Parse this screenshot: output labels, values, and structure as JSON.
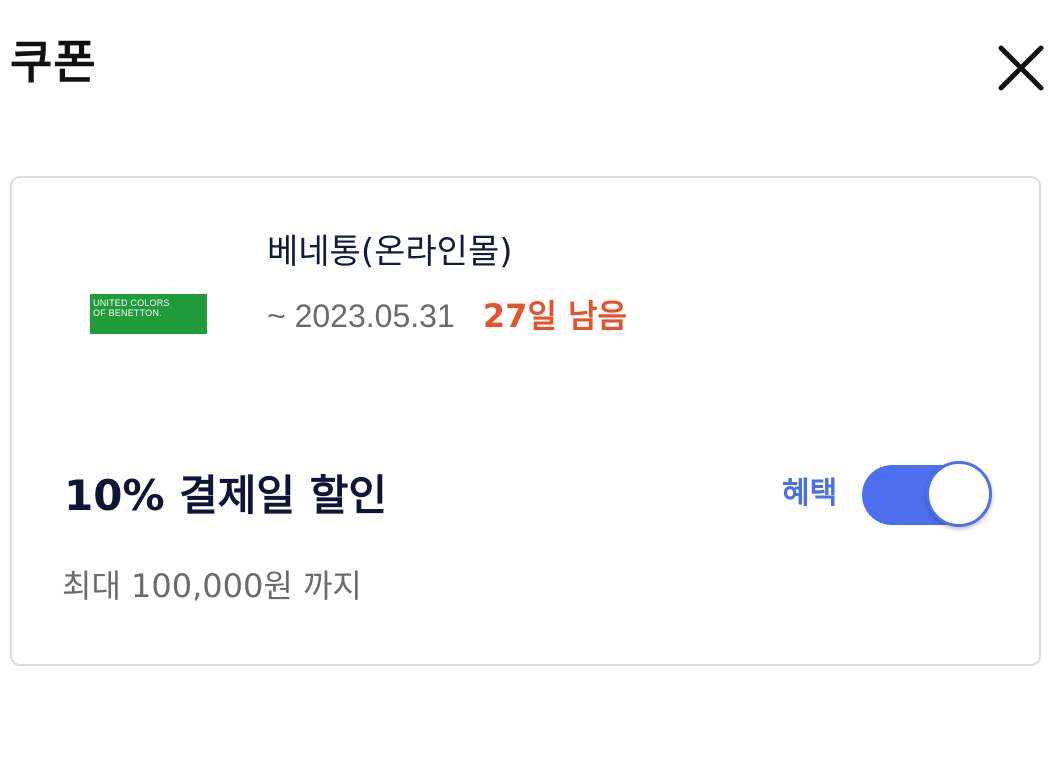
{
  "header": {
    "title": "쿠폰",
    "close_icon": "close-icon"
  },
  "coupon": {
    "logo": {
      "line1": "UNITED COLORS",
      "line2": "OF BENETTON.",
      "color": "#1f9b3a"
    },
    "brand_name": "베네통(온라인몰)",
    "expiry_date": "~ 2023.05.31",
    "days_left": "27일 남음",
    "discount_title": "10% 결제일 할인",
    "benefit_label": "혜택",
    "benefit_toggle_on": true,
    "limit_text": "최대 100,000원 까지"
  },
  "colors": {
    "accent": "#4e70f0",
    "days_left": "#e8512e",
    "brand_green": "#1f9b3a"
  }
}
